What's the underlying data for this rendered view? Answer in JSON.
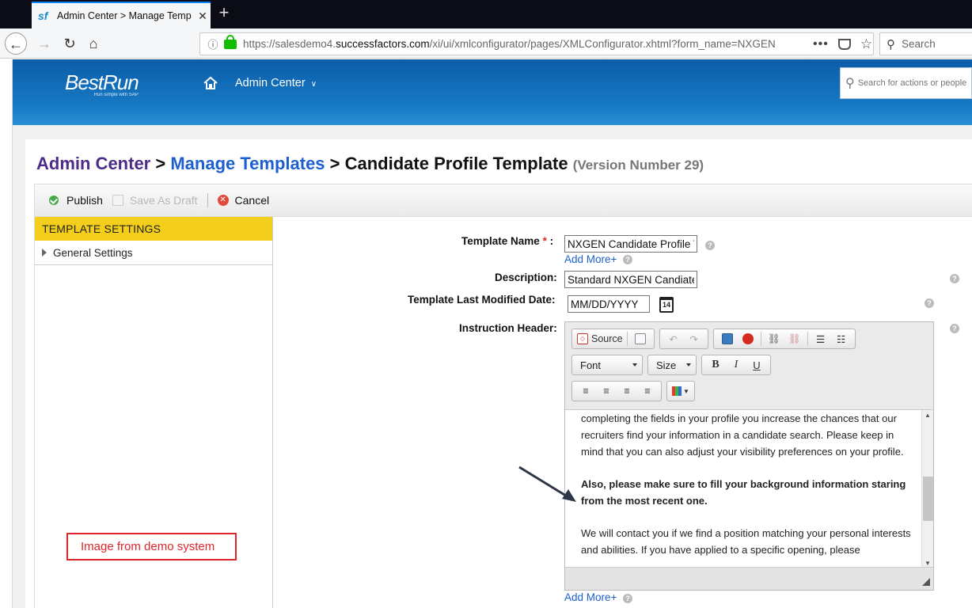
{
  "browser": {
    "tab_title": "Admin Center > Manage Temp",
    "tab_favicon": "sf",
    "url_prefix": "https://salesdemo4.",
    "url_domain": "successfactors.com",
    "url_rest": "/xi/ui/xmlconfigurator/pages/XMLConfigurator.xhtml?form_name=NXGEN",
    "search_placeholder": "Search"
  },
  "header": {
    "logo_text": "BestRun",
    "logo_tagline": "Run simple with SAP",
    "menu_label": "Admin Center",
    "search_placeholder": "Search for actions or people"
  },
  "breadcrumb": {
    "item1": "Admin Center",
    "sep": " > ",
    "item2": "Manage Templates",
    "current": "Candidate Profile Template",
    "version": "(Version Number 29)"
  },
  "toolbar": {
    "publish": "Publish",
    "save_draft": "Save As Draft",
    "cancel": "Cancel"
  },
  "left_panel": {
    "header": "TEMPLATE SETTINGS",
    "items": [
      "General Settings"
    ]
  },
  "annotation_note": "Image from demo system",
  "form": {
    "template_name_label": "Template Name",
    "required_mark": "*",
    "colon": ":",
    "template_name_value": "NXGEN Candidate Profile Te",
    "add_more": "Add More+",
    "description_label": "Description:",
    "description_value": "Standard NXGEN Candiate P",
    "modified_label": "Template Last Modified Date:",
    "modified_value": "MM/DD/YYYY",
    "calendar_day": "14",
    "instruction_label": "Instruction Header:",
    "help_glyph": "?"
  },
  "editor": {
    "source": "Source",
    "font": "Font",
    "size": "Size",
    "bold": "B",
    "italic": "I",
    "underline": "U",
    "paragraphs": [
      "completing the fields in your profile you increase the chances that our recruiters find your information in a candidate search. Please keep in mind that you can also adjust your visibility preferences on your profile.",
      "Also, please make sure to fill your background information staring from the most recent one.",
      "We will contact you if we find a position matching your personal interests and abilities. If you have applied to a specific opening, please"
    ]
  },
  "colors": {
    "header_blue": "#1779c4",
    "settings_yellow": "#f3ce1a",
    "link_blue": "#1d5fd0",
    "breadcrumb_purple": "#4b2c88",
    "note_red": "#e0262a"
  }
}
